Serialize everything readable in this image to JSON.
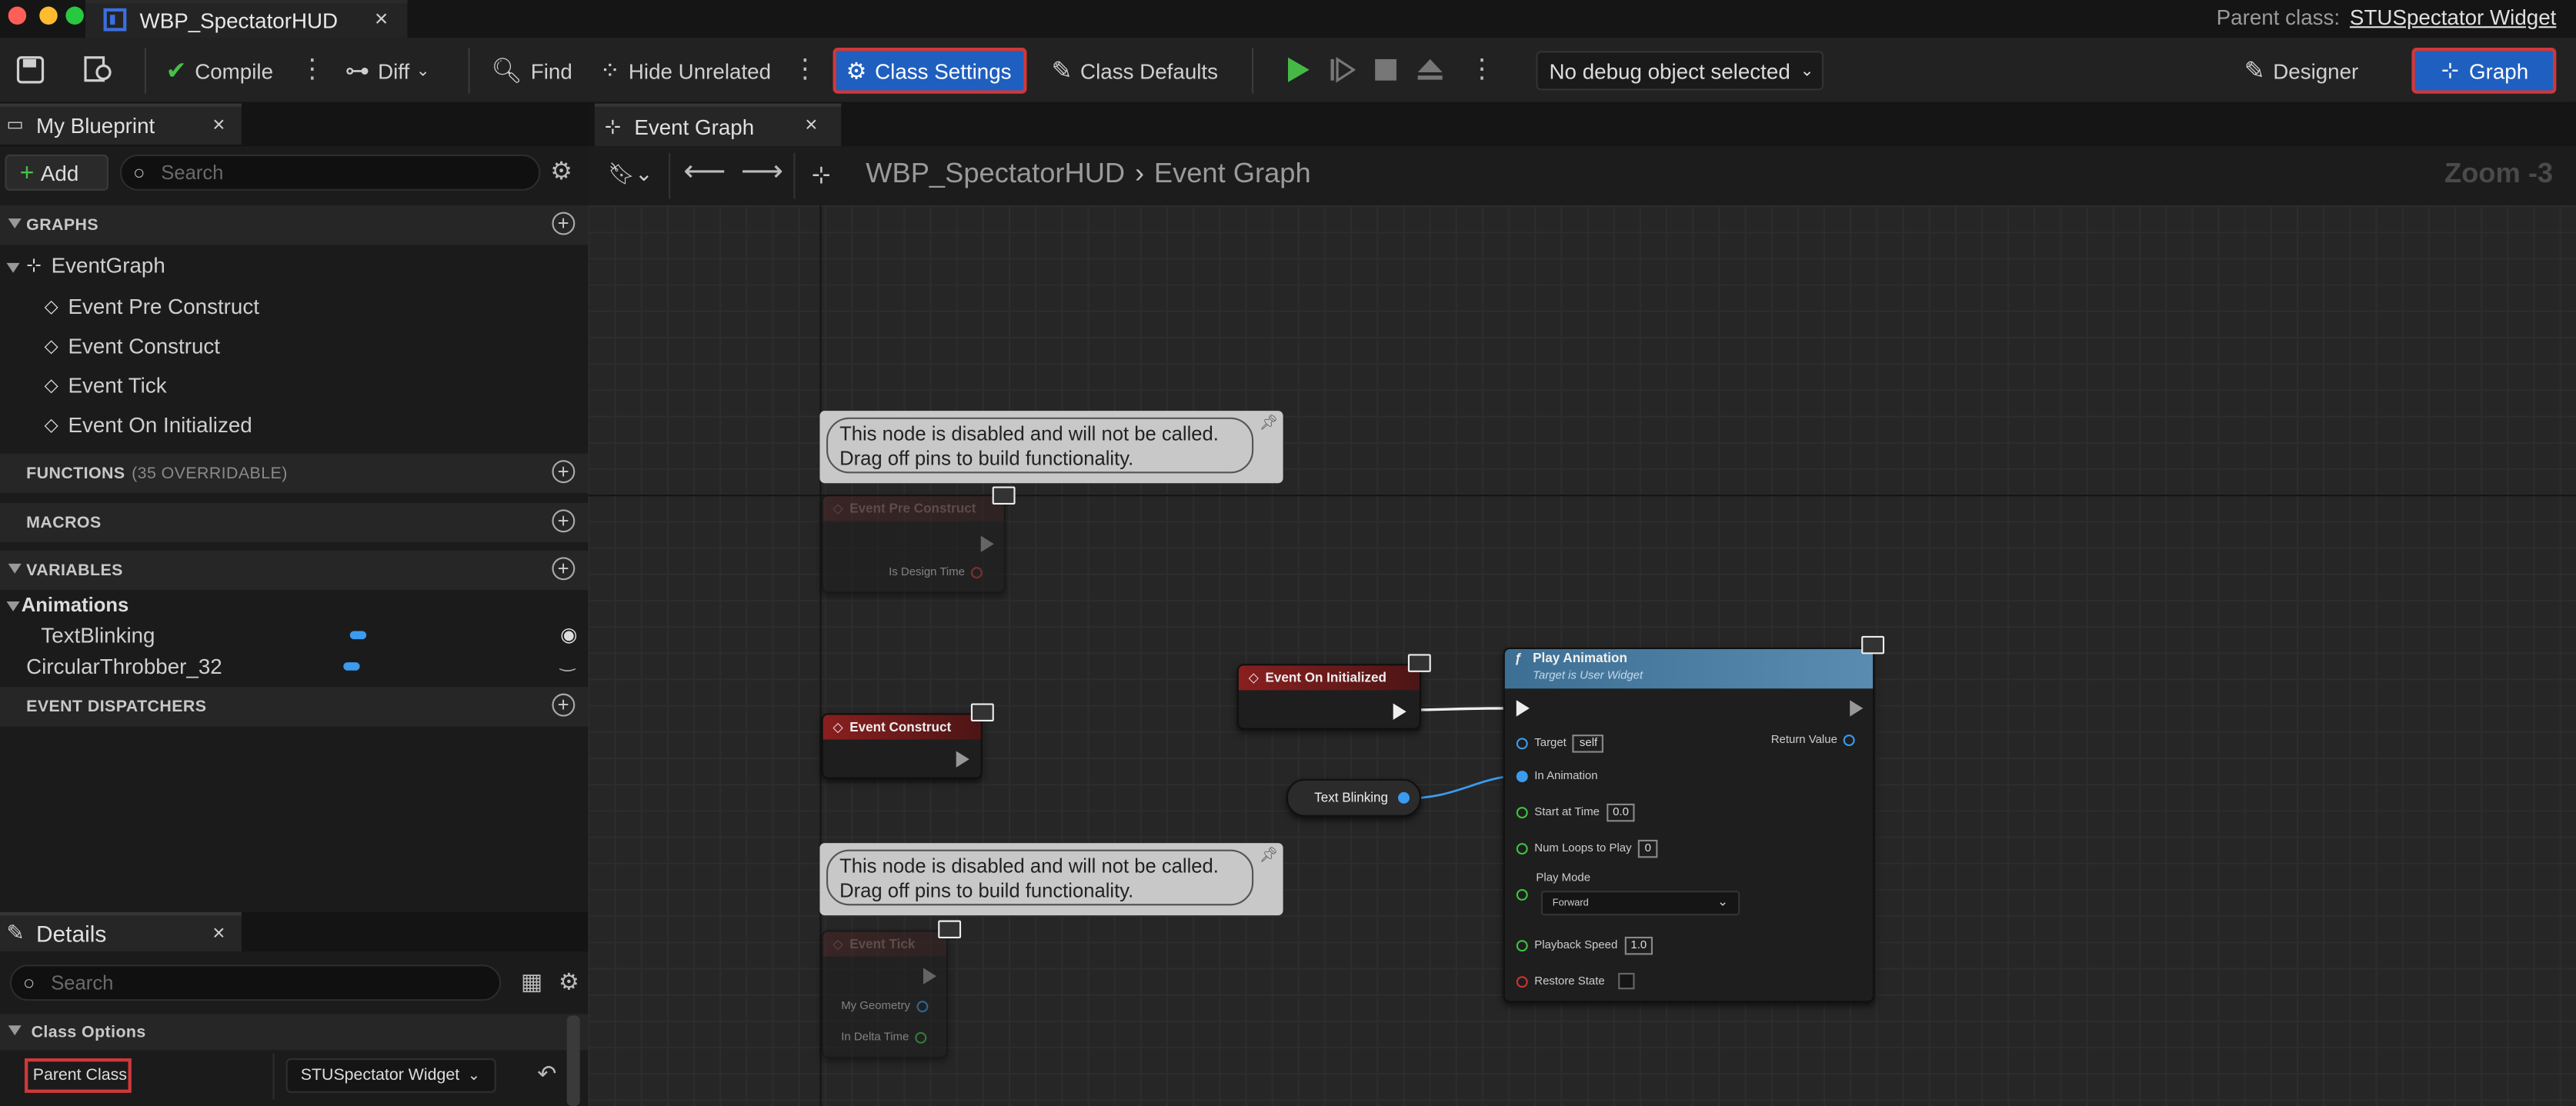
{
  "window": {
    "tab_title": "WBP_SpectatorHUD",
    "parent_class_label": "Parent class:",
    "parent_class_value": "STUSpectator Widget"
  },
  "toolbar": {
    "compile": "Compile",
    "diff": "Diff",
    "find": "Find",
    "hide_unrelated": "Hide Unrelated",
    "class_settings": "Class Settings",
    "class_defaults": "Class Defaults",
    "debug_object": "No debug object selected",
    "designer": "Designer",
    "graph": "Graph"
  },
  "my_blueprint": {
    "tab_label": "My Blueprint",
    "add_label": "Add",
    "search_placeholder": "Search",
    "graphs_header": "GRAPHS",
    "event_graph": "EventGraph",
    "events": [
      "Event Pre Construct",
      "Event Construct",
      "Event Tick",
      "Event On Initialized"
    ],
    "functions_header": "FUNCTIONS",
    "functions_overridable": "(35 OVERRIDABLE)",
    "macros_header": "MACROS",
    "variables_header": "VARIABLES",
    "animations_label": "Animations",
    "variables": [
      "TextBlinking",
      "CircularThrobber_32"
    ],
    "dispatchers_header": "EVENT DISPATCHERS"
  },
  "graph_editor": {
    "tab_label": "Event Graph",
    "breadcrumb_root": "WBP_SpectatorHUD",
    "breadcrumb_leaf": "Event Graph",
    "zoom_label": "Zoom -3",
    "comment_text_line1": "This node is disabled and will not be called.",
    "comment_text_line2": "Drag off pins to build functionality.",
    "nodes": {
      "pre_construct": {
        "title": "Event Pre Construct",
        "pin": "Is Design Time"
      },
      "construct": {
        "title": "Event Construct"
      },
      "on_initialized": {
        "title": "Event On Initialized"
      },
      "tick": {
        "title": "Event Tick",
        "pin_geometry": "My Geometry",
        "pin_delta": "In Delta Time"
      },
      "text_blinking": {
        "title": "Text Blinking"
      },
      "play_animation": {
        "title": "Play Animation",
        "subtitle": "Target is User Widget",
        "target": "Target",
        "target_value": "self",
        "return_value": "Return Value",
        "in_animation": "In Animation",
        "start_at_time": "Start at Time",
        "start_at_time_value": "0.0",
        "num_loops": "Num Loops to Play",
        "num_loops_value": "0",
        "play_mode": "Play Mode",
        "play_mode_value": "Forward",
        "playback_speed": "Playback Speed",
        "playback_speed_value": "1.0",
        "restore_state": "Restore State"
      }
    }
  },
  "details": {
    "tab_label": "Details",
    "search_placeholder": "Search",
    "class_options": "Class Options",
    "parent_class_label": "Parent Class",
    "parent_class_value": "STUSpectator Widget"
  }
}
